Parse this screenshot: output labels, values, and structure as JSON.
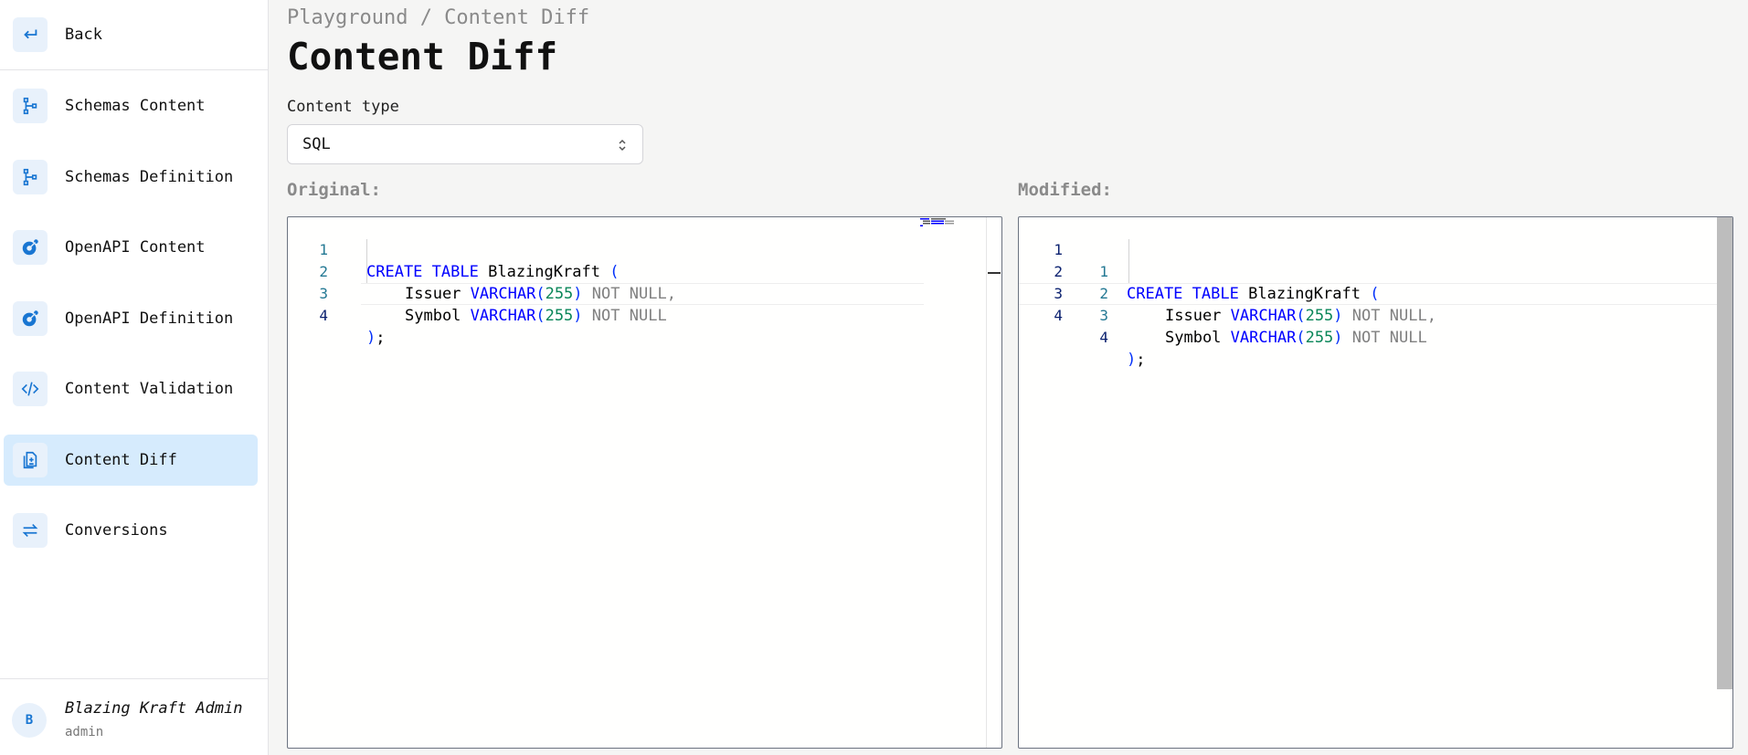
{
  "sidebar": {
    "back_label": "Back",
    "items": [
      {
        "label": "Schemas Content",
        "icon": "schema-tree-icon"
      },
      {
        "label": "Schemas Definition",
        "icon": "schema-tree-icon"
      },
      {
        "label": "OpenAPI Content",
        "icon": "openapi-icon"
      },
      {
        "label": "OpenAPI Definition",
        "icon": "openapi-icon"
      },
      {
        "label": "Content Validation",
        "icon": "code-icon"
      },
      {
        "label": "Content Diff",
        "icon": "diff-file-icon",
        "active": true
      },
      {
        "label": "Conversions",
        "icon": "swap-arrows-icon"
      }
    ],
    "user": {
      "initial": "B",
      "name": "Blazing Kraft Admin",
      "role": "admin"
    }
  },
  "main": {
    "breadcrumb": "Playground / Content Diff",
    "title": "Content Diff",
    "content_type_label": "Content type",
    "content_type_value": "SQL",
    "original_label": "Original:",
    "modified_label": "Modified:"
  },
  "code": {
    "line_numbers": [
      "1",
      "2",
      "3",
      "4"
    ],
    "line1": {
      "kw1": "CREATE",
      "kw2": "TABLE",
      "name": "BlazingKraft",
      "paren": "("
    },
    "line2": {
      "col": "Issuer",
      "type": "VARCHAR",
      "lp": "(",
      "num": "255",
      "rp": ")",
      "nn": "NOT NULL",
      "comma": ","
    },
    "line3": {
      "col": "Symbol",
      "type": "VARCHAR",
      "lp": "(",
      "num": "255",
      "rp": ")",
      "nn": "NOT NULL"
    },
    "line4": {
      "paren": ")",
      "semi": ";"
    }
  },
  "colors": {
    "accent": "#1976d2",
    "active_nav": "#d6ebfd",
    "keyword": "#0000ff",
    "number": "#098658",
    "comment_gray": "#808080"
  }
}
